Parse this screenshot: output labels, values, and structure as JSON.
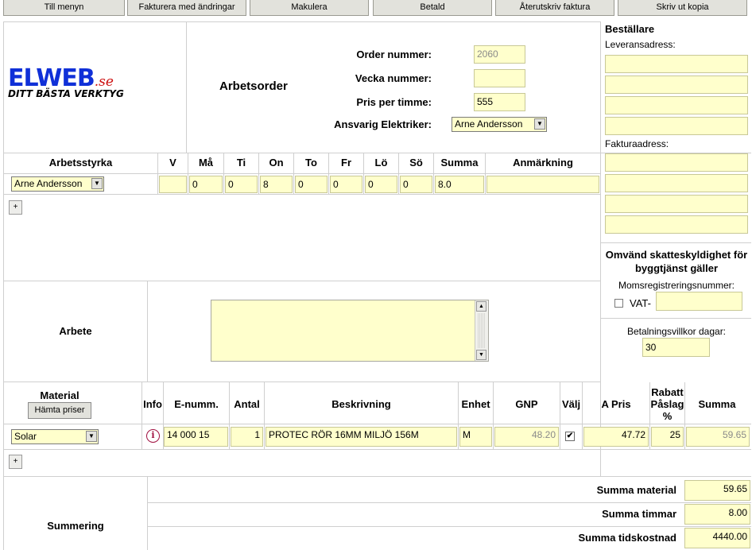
{
  "toolbar": {
    "buttons": [
      "Till menyn",
      "Fakturera med ändringar",
      "Makulera",
      "Betald",
      "Återutskriv faktura",
      "Skriv ut kopia"
    ]
  },
  "logo": {
    "brand": "ELWEB",
    "suffix": ".se",
    "tagline": "DITT BÄSTA VERKTYG",
    "brand_color": "#1030d8",
    "suffix_color": "#cc1010"
  },
  "header": {
    "title": "Arbetsorder",
    "order_label": "Order nummer:",
    "order_value": "2060",
    "week_label": "Vecka nummer:",
    "week_value": "",
    "price_label": "Pris per timme:",
    "price_value": "555",
    "electrician_label": "Ansvarig Elektriker:",
    "electrician_value": "Arne Andersson"
  },
  "orderer": {
    "title": "Beställare",
    "delivery_label": "Leveransadress:",
    "invoice_label": "Fakturaadress:"
  },
  "reverse_tax": {
    "title": "Omvänd skatteskyldighet för byggtjänst gäller",
    "vat_reg_label": "Momsregistreringsnummer:",
    "vat_prefix": "VAT-",
    "vat_value": ""
  },
  "payment": {
    "label": "Betalningsvillkor dagar:",
    "value": "30"
  },
  "workforce": {
    "headers": [
      "Arbetsstyrka",
      "V",
      "Må",
      "Ti",
      "On",
      "To",
      "Fr",
      "Lö",
      "Sö",
      "Summa",
      "Anmärkning"
    ],
    "row": {
      "worker": "Arne Andersson",
      "v": "",
      "ma": "0",
      "ti": "0",
      "on": "8",
      "to": "0",
      "fr": "0",
      "lo": "0",
      "so": "0",
      "summa": "8.0",
      "note": ""
    },
    "add_label": "+"
  },
  "work": {
    "label": "Arbete",
    "text": ""
  },
  "material": {
    "title": "Material",
    "fetch_button": "Hämta priser",
    "headers": [
      "Info",
      "E-numm.",
      "Antal",
      "Beskrivning",
      "Enhet",
      "GNP",
      "Välj",
      "A Pris",
      "Rabatt Påslag %",
      "Summa"
    ],
    "row": {
      "supplier": "Solar",
      "enumber": "14 000 15",
      "qty": "1",
      "description": "PROTEC RÖR 16MM MILJÖ 156M",
      "unit": "M",
      "gnp": "48.20",
      "selected": true,
      "price": "47.72",
      "discount": "25",
      "sum": "59.65"
    },
    "add_label": "+"
  },
  "summary": {
    "label": "Summering",
    "material_label": "Summa material",
    "material_value": "59.65",
    "hours_label": "Summa timmar",
    "hours_value": "8.00",
    "timecost_label": "Summa tidskostnad",
    "timecost_value": "4440.00"
  }
}
